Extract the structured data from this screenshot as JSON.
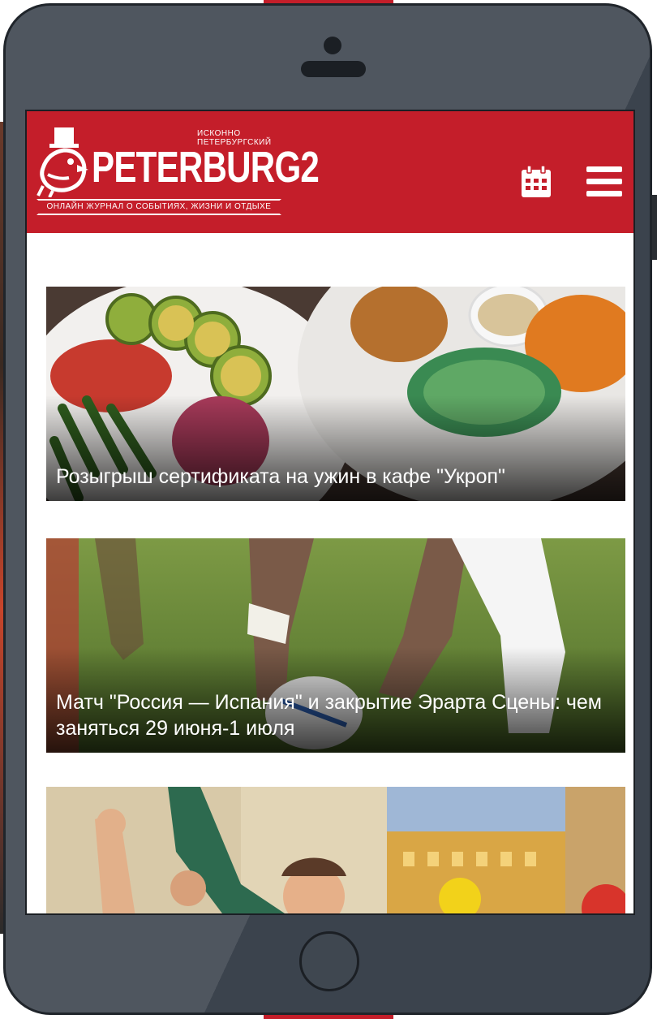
{
  "brand": {
    "name": "PETERBURG2",
    "tagline_top": "ИСКОННО ПЕТЕРБУРГСКИЙ",
    "tagline_bottom": "ОНЛАЙН ЖУРНАЛ О СОБЫТИЯХ, ЖИЗНИ И ОТДЫХЕ",
    "primary_color": "#c41e2a"
  },
  "header": {
    "icons": [
      "calendar-icon",
      "menu-icon"
    ]
  },
  "articles": [
    {
      "title": "Розыгрыш сертификата на ужин в кафе \"Укроп\""
    },
    {
      "title": "Матч \"Россия — Испания\" и закрытие Эрарта Сцены: чем заняться 29 июня-1 июля"
    },
    {
      "title": ""
    }
  ]
}
